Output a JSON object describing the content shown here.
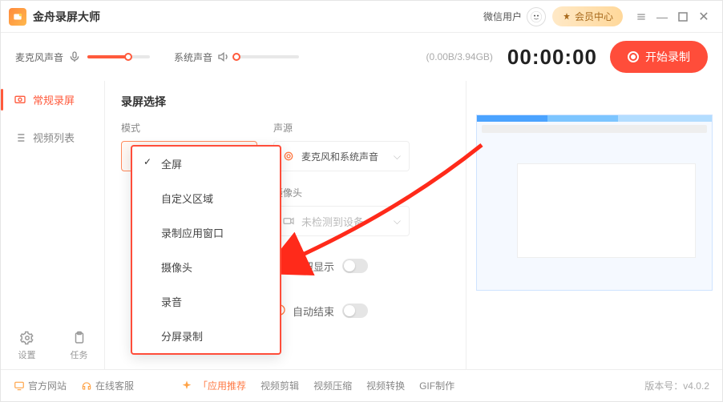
{
  "app": {
    "title": "金舟录屏大师"
  },
  "titlebar": {
    "user_label": "微信用户",
    "vip_label": "会员中心"
  },
  "audio": {
    "mic_label": "麦克风声音",
    "system_label": "系统声音",
    "mic_pct": 65,
    "system_pct": 0
  },
  "storage": "(0.00B/3.94GB)",
  "timer": "00:00:00",
  "record_button": "开始录制",
  "sidebar": {
    "items": [
      {
        "label": "常规录屏"
      },
      {
        "label": "视频列表"
      }
    ],
    "settings": "设置",
    "tasks": "任务"
  },
  "panel": {
    "title": "录屏选择",
    "mode_label": "模式",
    "mode_value": "全屏",
    "audio_source_label": "声源",
    "audio_source_value": "麦克风和系统声音",
    "camera_label": "摄像头",
    "camera_value": "未检测到设备",
    "buttons_show_label": "按钮显示",
    "auto_end_label": "自动结束"
  },
  "dropdown": {
    "items": [
      "全屏",
      "自定义区域",
      "录制应用窗口",
      "摄像头",
      "录音",
      "分屏录制"
    ],
    "selected_index": 0
  },
  "bottom": {
    "official_site": "官方网站",
    "online_cs": "在线客服",
    "app_recommend": "「应用推荐",
    "video_edit": "视频剪辑",
    "video_compress": "视频压缩",
    "video_convert": "视频转换",
    "gif_make": "GIF制作",
    "version": "版本号：v4.0.2"
  }
}
